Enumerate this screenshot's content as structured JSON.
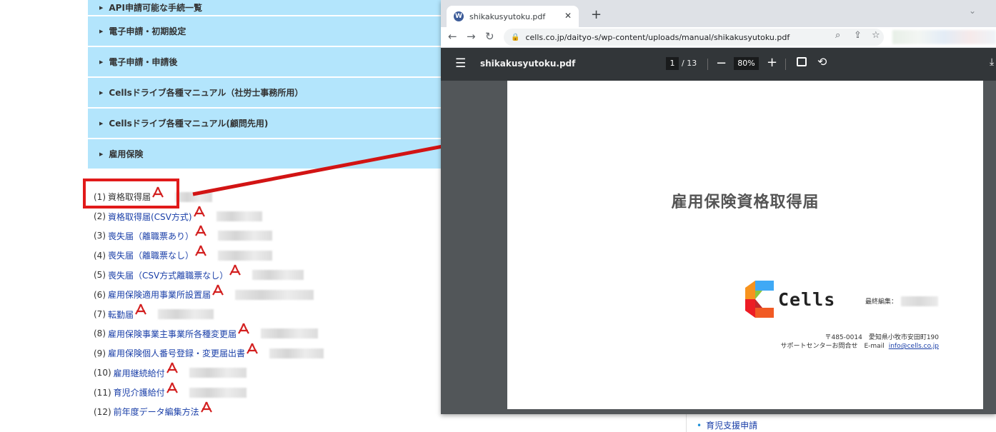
{
  "page": {
    "accordion": [
      "API申請可能な手続一覧",
      "電子申請・初期設定",
      "電子申請・申請後",
      "Cellsドライブ各種マニュアル（社労士事務所用）",
      "Cellsドライブ各種マニュアル(顧問先用)",
      "雇用保険"
    ],
    "documents": [
      {
        "num": "(1)",
        "title": "資格取得届"
      },
      {
        "num": "(2)",
        "title": "資格取得届(CSV方式)"
      },
      {
        "num": "(3)",
        "title": "喪失届（離職票あり）"
      },
      {
        "num": "(4)",
        "title": "喪失届（離職票なし）"
      },
      {
        "num": "(5)",
        "title": "喪失届（CSV方式離職票なし）"
      },
      {
        "num": "(6)",
        "title": "雇用保険適用事業所設置届"
      },
      {
        "num": "(7)",
        "title": "転勤届"
      },
      {
        "num": "(8)",
        "title": "雇用保険事業主事業所各種変更届"
      },
      {
        "num": "(9)",
        "title": "雇用保険個人番号登録・変更届出書"
      },
      {
        "num": "(10)",
        "title": "雇用継続給付"
      },
      {
        "num": "(11)",
        "title": "育児介護給付"
      },
      {
        "num": "(12)",
        "title": "前年度データ編集方法"
      }
    ],
    "right_item": "育児支援申請"
  },
  "browser": {
    "tab_title": "shikakusyutoku.pdf",
    "tab_favicon": "W",
    "url": "cells.co.jp/daityo-s/wp-content/uploads/manual/shikakusyutoku.pdf",
    "pdf": {
      "filename": "shikakusyutoku.pdf",
      "current_page": "1",
      "total_pages": "/ 13",
      "zoom": "80%"
    },
    "document": {
      "heading": "雇用保険資格取得届",
      "logo_text": "Cells",
      "edit_label": "最終編集：",
      "address": "〒485-0014　愛知県小牧市安田町190",
      "contact_label": "サポートセンターお問合せ　E-mail",
      "email": "info@cells.co.jp"
    }
  },
  "colors": {
    "accordion_bg": "#b3e5fc",
    "link": "#1a3fa8",
    "highlight": "#e11a1a",
    "pdf_toolbar": "#323639",
    "pdf_bg": "#525659"
  }
}
